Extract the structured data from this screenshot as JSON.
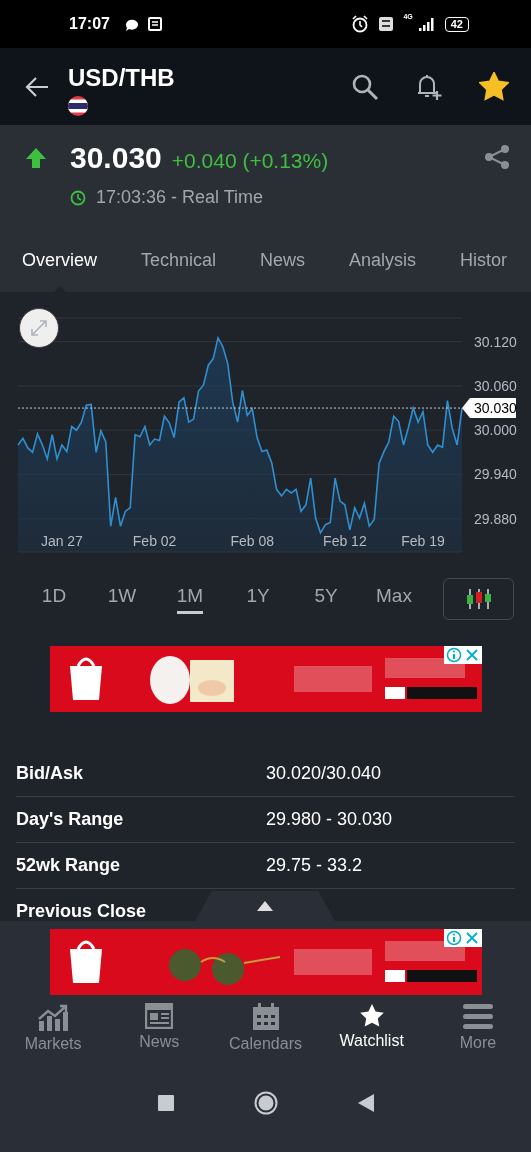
{
  "status_bar": {
    "time": "17:07",
    "network": "4G",
    "battery": "42"
  },
  "header": {
    "title": "USD/THB",
    "watchlisted": true
  },
  "quote": {
    "rising": true,
    "price": "30.030",
    "change": "+0.040 (+0.13%)",
    "time": "17:03:36 - Real Time"
  },
  "tabs": [
    {
      "label": "Overview",
      "selected": true
    },
    {
      "label": "Technical",
      "selected": false
    },
    {
      "label": "News",
      "selected": false
    },
    {
      "label": "Analysis",
      "selected": false
    },
    {
      "label": "Histor",
      "selected": false
    }
  ],
  "chart": {
    "chart_data": {
      "type": "area",
      "categories": [
        null,
        null,
        null,
        null,
        null,
        null,
        null,
        null,
        null,
        "Jan 27",
        null,
        null,
        null,
        null,
        null,
        null,
        null,
        null,
        null,
        null,
        null,
        null,
        null,
        null,
        null,
        null,
        null,
        null,
        "Feb 02",
        null,
        null,
        null,
        null,
        null,
        null,
        null,
        null,
        null,
        null,
        null,
        null,
        null,
        null,
        null,
        null,
        null,
        null,
        null,
        "Feb 08",
        null,
        null,
        null,
        null,
        null,
        null,
        null,
        null,
        null,
        null,
        null,
        null,
        null,
        null,
        null,
        null,
        null,
        null,
        "Feb 12",
        null,
        null,
        null,
        null,
        null,
        null,
        null,
        null,
        null,
        null,
        null,
        null,
        null,
        null,
        null,
        "Feb 19",
        null,
        null,
        null,
        null,
        null,
        null,
        null,
        null
      ],
      "series": [
        {
          "color": "#2f8fd0",
          "values": [
            29.98,
            29.989,
            29.976,
            29.97,
            29.995,
            29.98,
            29.961,
            29.994,
            29.961,
            29.98,
            29.971,
            30.005,
            30.0,
            30.011,
            30.034,
            30.035,
            29.97,
            29.999,
            29.984,
            29.87,
            29.909,
            29.87,
            29.89,
            29.895,
            29.994,
            29.991,
            30.005,
            29.98,
            29.988,
            29.986,
            30.019,
            30.01,
            29.99,
            30.038,
            30.044,
            30.011,
            30.015,
            30.053,
            30.061,
            30.088,
            30.097,
            30.125,
            30.113,
            30.09,
            30.038,
            30.011,
            30.054,
            30.02,
            30.029,
            29.99,
            29.971,
            29.973,
            29.956,
            29.92,
            29.911,
            29.92,
            29.915,
            29.92,
            29.89,
            29.899,
            29.935,
            29.881,
            29.861,
            29.872,
            29.875,
            29.935,
            29.904,
            29.899,
            29.865,
            29.895,
            29.881,
            29.901,
            29.87,
            29.879,
            29.955,
            29.971,
            29.984,
            30.019,
            30.012,
            29.98,
            30.003,
            30.03,
            30.011,
            30.025,
            29.98,
            29.97,
            29.98,
            29.977,
            30.04,
            30.003,
            29.98,
            30.03
          ]
        }
      ],
      "grid": true,
      "ylim": [
        29.835,
        30.152
      ],
      "yticks": [
        {
          "value": 30.12,
          "label": "30.120"
        },
        {
          "value": 30.06,
          "label": "30.060"
        },
        {
          "value": 30.0,
          "label": "30.000"
        },
        {
          "value": 29.94,
          "label": "29.940"
        },
        {
          "value": 29.88,
          "label": "29.880"
        }
      ],
      "ref_lines": [
        {
          "axis": "y",
          "value": 30.03,
          "label": "30.030"
        }
      ]
    }
  },
  "periods": [
    {
      "label": "1D",
      "selected": false
    },
    {
      "label": "1W",
      "selected": false
    },
    {
      "label": "1M",
      "selected": true
    },
    {
      "label": "1Y",
      "selected": false
    },
    {
      "label": "5Y",
      "selected": false
    },
    {
      "label": "Max",
      "selected": false
    }
  ],
  "details": [
    {
      "label": "Bid/Ask",
      "value": "30.020/30.040"
    },
    {
      "label": "Day's Range",
      "value": "29.980 - 30.030"
    },
    {
      "label": "52wk Range",
      "value": "29.75 - 33.2"
    },
    {
      "label": "Previous Close"
    }
  ],
  "bottom_nav": [
    {
      "label": "Markets",
      "selected": false
    },
    {
      "label": "News",
      "selected": false
    },
    {
      "label": "Calendars",
      "selected": false
    },
    {
      "label": "Watchlist",
      "selected": true
    },
    {
      "label": "More",
      "selected": false
    }
  ]
}
